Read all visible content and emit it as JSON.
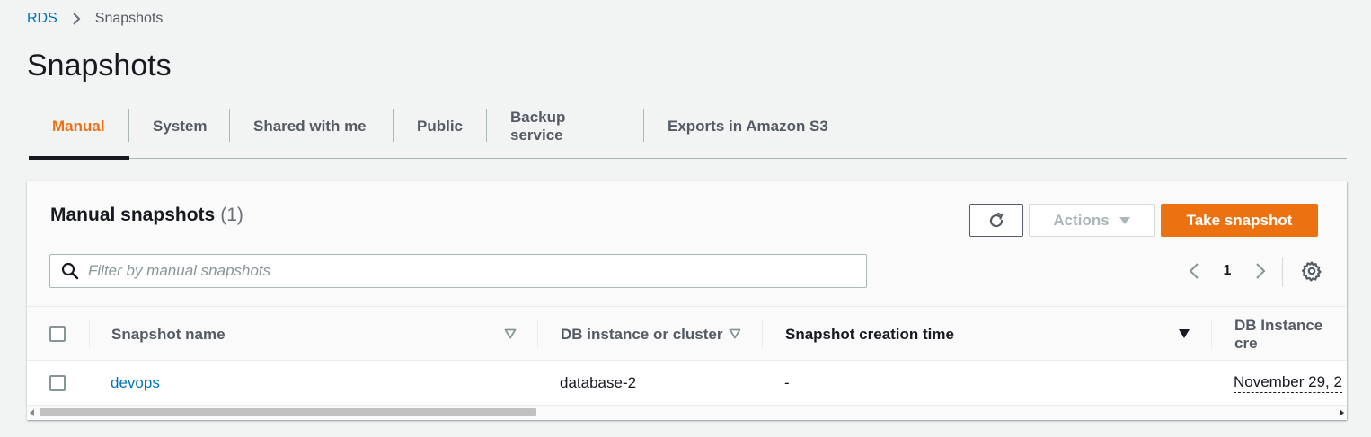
{
  "breadcrumb": {
    "items": [
      {
        "label": "RDS"
      },
      {
        "label": "Snapshots"
      }
    ]
  },
  "page": {
    "title": "Snapshots"
  },
  "tabs": [
    {
      "label": "Manual",
      "active": true
    },
    {
      "label": "System"
    },
    {
      "label": "Shared with me"
    },
    {
      "label": "Public"
    },
    {
      "label": "Backup service"
    },
    {
      "label": "Exports in Amazon S3"
    }
  ],
  "panel": {
    "title": "Manual snapshots",
    "count": "(1)",
    "refresh_icon": "refresh-icon",
    "actions_label": "Actions",
    "take_snapshot_label": "Take snapshot",
    "search_placeholder": "Filter by manual snapshots",
    "search_value": "",
    "pagination": {
      "current_page": "1"
    }
  },
  "table": {
    "columns": [
      {
        "label": "Snapshot name"
      },
      {
        "label": "DB instance or cluster"
      },
      {
        "label": "Snapshot creation time"
      },
      {
        "label": "DB Instance cre"
      }
    ],
    "rows": [
      {
        "snapshot_name": "devops",
        "db_instance": "database-2",
        "creation_time": "-",
        "db_instance_created": "November 29, 2"
      }
    ]
  },
  "colors": {
    "accent": "#ec7211",
    "link": "#0073bb",
    "background": "#f2f3f3"
  }
}
